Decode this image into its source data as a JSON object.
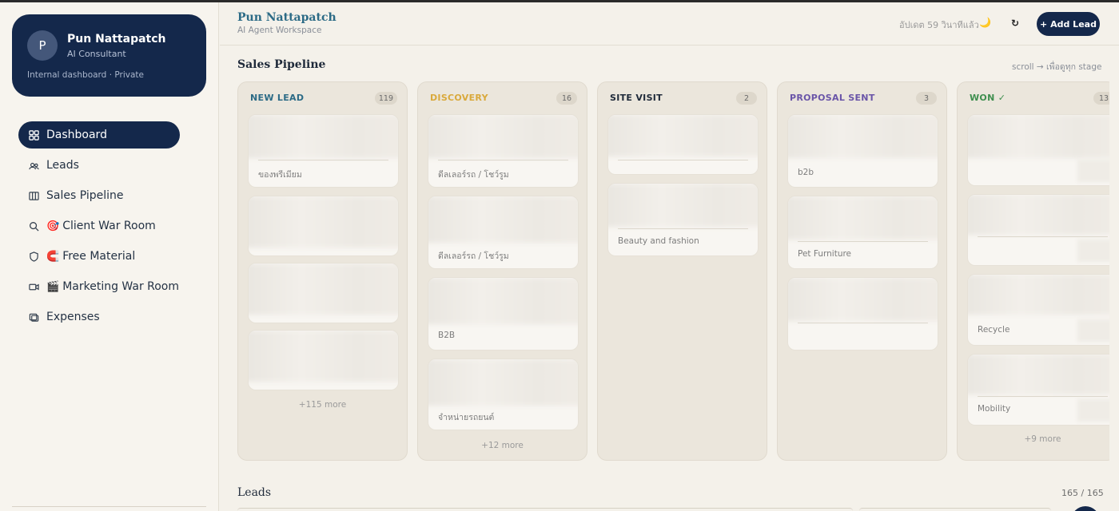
{
  "sidebar": {
    "profile": {
      "initial": "P",
      "name": "Pun Nattapatch",
      "role": "AI Consultant",
      "note": "Internal dashboard · Private"
    },
    "items": [
      {
        "label": "Dashboard",
        "icon": "grid-icon",
        "emoji": "",
        "active": true
      },
      {
        "label": "Leads",
        "icon": "users-icon",
        "emoji": ""
      },
      {
        "label": "Sales Pipeline",
        "icon": "columns-icon",
        "emoji": ""
      },
      {
        "label": "Client War Room",
        "icon": "search-icon",
        "emoji": "🎯"
      },
      {
        "label": "Free Material",
        "icon": "shield-icon",
        "emoji": "🧲"
      },
      {
        "label": "Marketing War Room",
        "icon": "video-icon",
        "emoji": "🎬"
      },
      {
        "label": "Expenses",
        "icon": "receipt-icon",
        "emoji": ""
      }
    ]
  },
  "header": {
    "title": "Pun Nattapatch",
    "subtitle": "AI Agent Workspace",
    "updated": "อัปเดต 59 วินาทีแล้ว",
    "theme_icon": "🌙",
    "refresh_icon": "↻",
    "add_button": "+ Add Lead"
  },
  "pipeline": {
    "title": "Sales Pipeline",
    "scroll_hint": "scroll → เพื่อดูทุก stage",
    "columns": [
      {
        "name": "NEW LEAD",
        "count": "119",
        "color": "#2c6b86",
        "cards": [
          "ของพรีเมียม",
          "",
          "",
          ""
        ],
        "more": "+115 more"
      },
      {
        "name": "DISCOVERY",
        "count": "16",
        "color": "#d9a93c",
        "cards": [
          "ดีลเลอร์รถ / โชว์รูม",
          "ดีลเลอร์รถ / โชว์รูม",
          "B2B",
          "จำหน่ายรถยนต์"
        ],
        "more": "+12 more"
      },
      {
        "name": "SITE VISIT",
        "count": "2",
        "color": "#1f2a3a",
        "cards": [
          "",
          "Beauty and fashion"
        ],
        "more": ""
      },
      {
        "name": "PROPOSAL SENT",
        "count": "3",
        "color": "#6a55a8",
        "cards": [
          "b2b",
          "Pet Furniture",
          ""
        ],
        "more": ""
      },
      {
        "name": "WON ✓",
        "count": "13",
        "color": "#3f8f4f",
        "cards": [
          "",
          "",
          "Recycle",
          "Mobility"
        ],
        "more": "+9 more"
      }
    ]
  },
  "leads": {
    "title": "Leads",
    "count": "165 / 165"
  }
}
